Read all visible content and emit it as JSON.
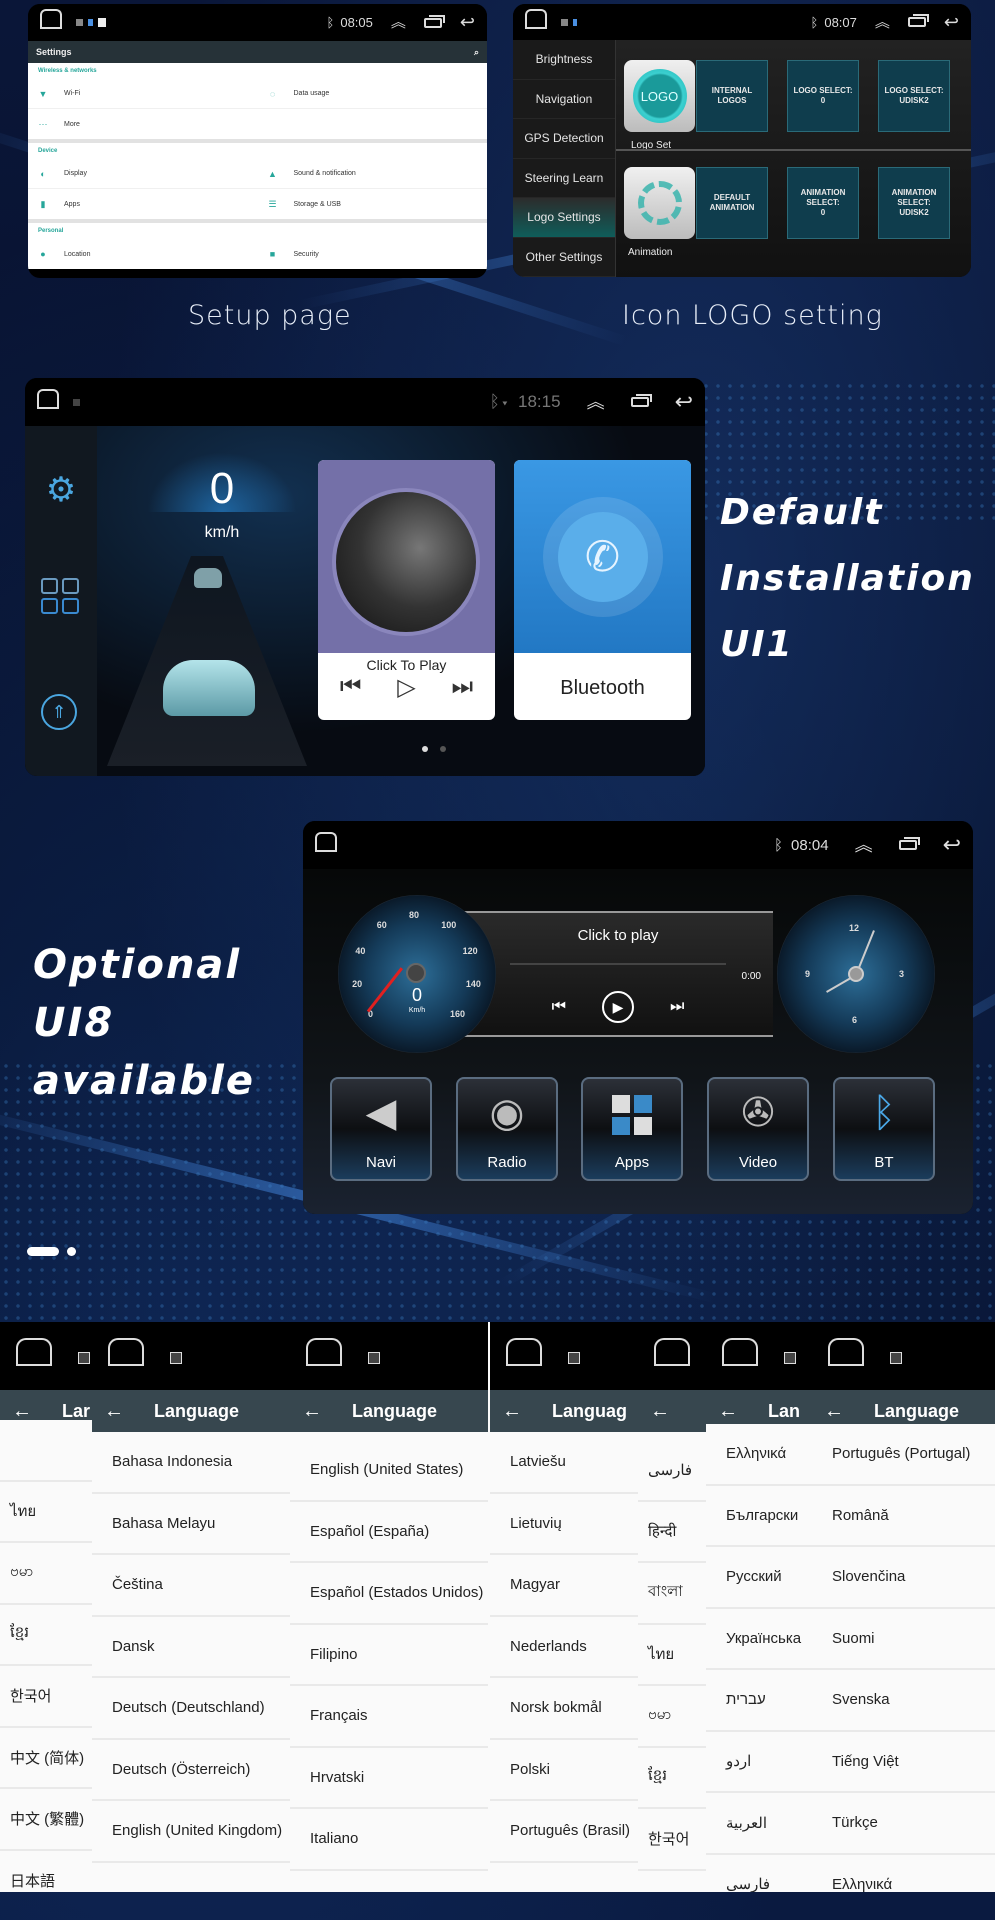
{
  "captions": {
    "setup_page": "Setup page",
    "icon_logo": "Icon LOGO setting",
    "default_ui1": [
      "Default",
      "Installation",
      "UI1"
    ],
    "optional_ui8": [
      "Optional",
      "UI8",
      "available"
    ]
  },
  "settings_panel": {
    "status": {
      "time": "08:05"
    },
    "title": "Settings",
    "sections": [
      {
        "header": "Wireless & networks",
        "rows": [
          [
            "Wi-Fi",
            "Data usage"
          ],
          [
            "More",
            ""
          ]
        ]
      },
      {
        "header": "Device",
        "rows": [
          [
            "Display",
            "Sound & notification"
          ],
          [
            "Apps",
            "Storage & USB"
          ]
        ]
      },
      {
        "header": "Personal",
        "rows": [
          [
            "Location",
            "Security"
          ]
        ]
      }
    ]
  },
  "logo_panel": {
    "status": {
      "time": "08:07"
    },
    "menu": [
      "Brightness",
      "Navigation",
      "GPS Detection",
      "Steering Learn",
      "Logo Settings",
      "Other Settings"
    ],
    "active_menu": "Logo Settings",
    "logo_set": {
      "icon_text": "LOGO",
      "label": "Logo Set",
      "tiles": [
        "INTERNAL LOGOS",
        "LOGO SELECT:\n0",
        "LOGO SELECT:\nUDISK2"
      ]
    },
    "animation": {
      "label": "Animation",
      "tiles": [
        "DEFAULT\nANIMATION",
        "ANIMATION\nSELECT:\n0",
        "ANIMATION\nSELECT:\nUDISK2"
      ]
    }
  },
  "ui1_panel": {
    "status": {
      "time": "18:15"
    },
    "speed": "0",
    "speed_unit": "km/h",
    "music_card": {
      "label": "Click To Play"
    },
    "bt_card": {
      "label": "Bluetooth"
    },
    "page_indicator": {
      "pages": 2,
      "current": 1
    }
  },
  "ui8_panel": {
    "status": {
      "time": "08:04"
    },
    "speedo": {
      "ticks": [
        "0",
        "20",
        "40",
        "60",
        "80",
        "100",
        "120",
        "140",
        "160"
      ],
      "value": "0",
      "unit": "Km/h"
    },
    "clock": {
      "numbers": [
        "12",
        "3",
        "6",
        "9"
      ]
    },
    "media": {
      "title": "Click to play",
      "elapsed": "0:00",
      "total": "0:00"
    },
    "apps": [
      "Navi",
      "Radio",
      "Apps",
      "Video",
      "BT"
    ]
  },
  "carousel": {
    "pages": 2,
    "current": 1
  },
  "language_panels": {
    "title": "Language",
    "columns": [
      {
        "title": "Lar",
        "items": [
          "",
          "ไทย",
          "ဗမာ",
          "ខ្មែរ",
          "한국어",
          "中文 (简体)",
          "中文 (繁體)",
          "日本語"
        ]
      },
      {
        "title": "Language",
        "items": [
          "Bahasa Indonesia",
          "Bahasa Melayu",
          "Čeština",
          "Dansk",
          "Deutsch (Deutschland)",
          "Deutsch (Österreich)",
          "English (United Kingdom)"
        ]
      },
      {
        "title": "Language",
        "items": [
          "English (United States)",
          "Español (España)",
          "Español (Estados Unidos)",
          "Filipino",
          "Français",
          "Hrvatski",
          "Italiano"
        ]
      },
      {
        "title": "Languag",
        "items": [
          "Latviešu",
          "Lietuvių",
          "Magyar",
          "Nederlands",
          "Norsk bokmål",
          "Polski",
          "Português (Brasil)"
        ]
      },
      {
        "title": "",
        "items": [
          "فارسی",
          "हिन्दी",
          "বাংলা",
          "ไทย",
          "ဗမာ",
          "ខ្មែរ",
          "한국어"
        ]
      },
      {
        "title": "Lan",
        "items": [
          "Ελληνικά",
          "Български",
          "Русский",
          "Українська",
          "עברית",
          "اردو",
          "العربية",
          "فارسی"
        ]
      },
      {
        "title": "Language",
        "items": [
          "Português (Portugal)",
          "Română",
          "Slovenčina",
          "Suomi",
          "Svenska",
          "Tiếng Việt",
          "Türkçe",
          "Ελληνικά"
        ]
      }
    ]
  }
}
